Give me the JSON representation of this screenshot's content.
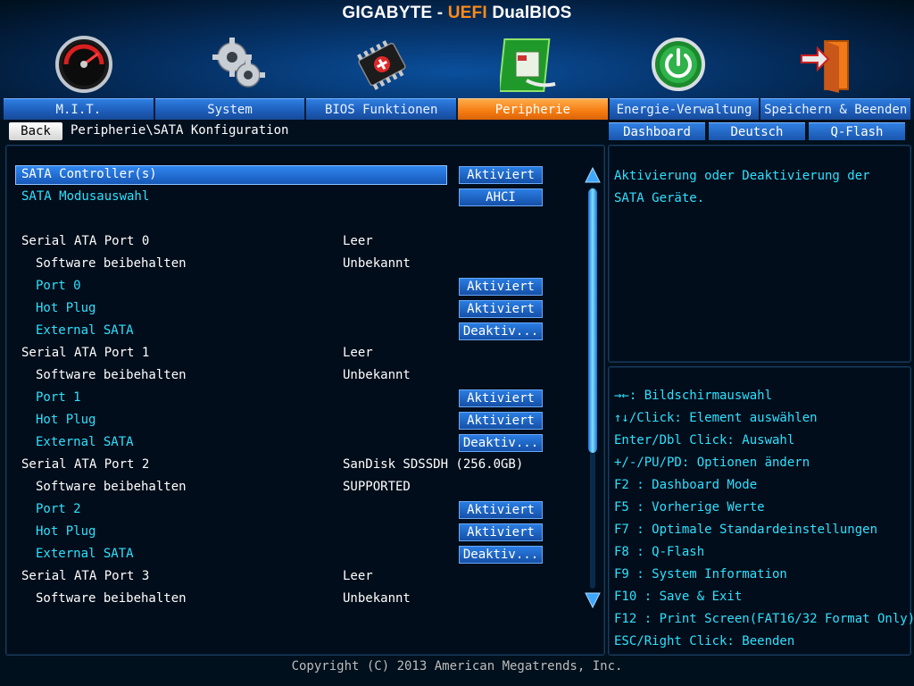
{
  "title": {
    "brand": "GIGABYTE - ",
    "accent": "UEFI",
    "rest": " DualBIOS"
  },
  "tabs": [
    {
      "label": "M.I.T.",
      "icon": "speedometer-icon"
    },
    {
      "label": "System",
      "icon": "gears-icon"
    },
    {
      "label": "BIOS Funktionen",
      "icon": "chip-icon"
    },
    {
      "label": "Peripherie",
      "icon": "peripheral-board-icon",
      "active": true
    },
    {
      "label": "Energie-Verwaltung",
      "icon": "power-icon"
    },
    {
      "label": "Speichern & Beenden",
      "icon": "exit-door-icon"
    }
  ],
  "subbar": {
    "back_label": "Back",
    "breadcrumb": "Peripherie\\SATA Konfiguration",
    "quick_buttons": [
      "Dashboard",
      "Deutsch",
      "Q-Flash"
    ]
  },
  "settings": [
    {
      "label": "SATA Controller(s)",
      "color": "white",
      "indent": 0,
      "button": "Aktiviert",
      "selected": true
    },
    {
      "label": "SATA Modusauswahl",
      "color": "cyan",
      "indent": 0,
      "button": "AHCI"
    },
    {
      "spacer": true
    },
    {
      "label": "Serial ATA Port 0",
      "color": "white",
      "indent": 0,
      "value": "Leer"
    },
    {
      "label": "Software beibehalten",
      "color": "white",
      "indent": 1,
      "value": "Unbekannt"
    },
    {
      "label": "Port 0",
      "color": "cyan",
      "indent": 1,
      "button": "Aktiviert"
    },
    {
      "label": "Hot Plug",
      "color": "cyan",
      "indent": 1,
      "button": "Aktiviert"
    },
    {
      "label": "External SATA",
      "color": "cyan",
      "indent": 1,
      "button": "Deaktiv..."
    },
    {
      "label": "Serial ATA Port 1",
      "color": "white",
      "indent": 0,
      "value": "Leer"
    },
    {
      "label": "Software beibehalten",
      "color": "white",
      "indent": 1,
      "value": "Unbekannt"
    },
    {
      "label": "Port 1",
      "color": "cyan",
      "indent": 1,
      "button": "Aktiviert"
    },
    {
      "label": "Hot Plug",
      "color": "cyan",
      "indent": 1,
      "button": "Aktiviert"
    },
    {
      "label": "External SATA",
      "color": "cyan",
      "indent": 1,
      "button": "Deaktiv..."
    },
    {
      "label": "Serial ATA Port 2",
      "color": "white",
      "indent": 0,
      "value": "SanDisk SDSSDH (256.0GB)"
    },
    {
      "label": "Software beibehalten",
      "color": "white",
      "indent": 1,
      "value": "SUPPORTED"
    },
    {
      "label": "Port 2",
      "color": "cyan",
      "indent": 1,
      "button": "Aktiviert"
    },
    {
      "label": "Hot Plug",
      "color": "cyan",
      "indent": 1,
      "button": "Aktiviert"
    },
    {
      "label": "External SATA",
      "color": "cyan",
      "indent": 1,
      "button": "Deaktiv..."
    },
    {
      "label": "Serial ATA Port 3",
      "color": "white",
      "indent": 0,
      "value": "Leer"
    },
    {
      "label": "Software beibehalten",
      "color": "white",
      "indent": 1,
      "value": "Unbekannt"
    }
  ],
  "help_text": "Aktivierung oder Deaktivierung der SATA Geräte.",
  "key_help": [
    "→←: Bildschirmauswahl",
    "↑↓/Click: Element auswählen",
    "Enter/Dbl Click: Auswahl",
    "+/-/PU/PD: Optionen ändern",
    "F2  : Dashboard Mode",
    "F5  : Vorherige Werte",
    "F7  : Optimale Standardeinstellungen",
    "F8  : Q-Flash",
    "F9  : System Information",
    "F10 : Save & Exit",
    "F12 : Print Screen(FAT16/32 Format Only)",
    "ESC/Right Click: Beenden"
  ],
  "copyright": "Copyright (C) 2013 American Megatrends, Inc.",
  "colors": {
    "accent_orange": "#f57b10",
    "tab_blue": "#1d5cb8",
    "text_cyan": "#2fe0ff",
    "panel_bg": "#010d1a"
  }
}
